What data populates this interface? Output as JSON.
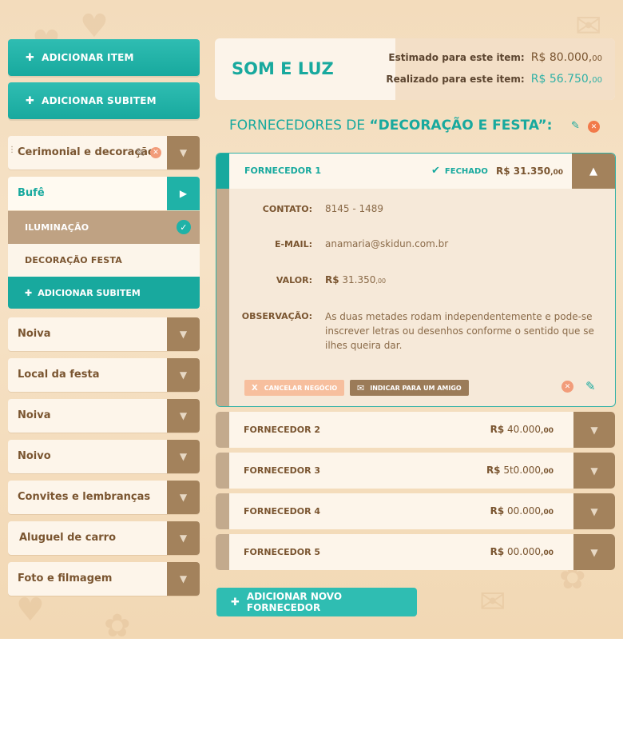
{
  "sidebar": {
    "add_item_label": "ADICIONAR ITEM",
    "add_subitem_label": "ADICIONAR SUBITEM",
    "categories": [
      {
        "label": "Cerimonial e decoração"
      },
      {
        "label": "Bufê"
      },
      {
        "label": "Noiva"
      },
      {
        "label": "Local da festa"
      },
      {
        "label": "Noiva"
      },
      {
        "label": "Noivo"
      },
      {
        "label": "Convites e lembranças"
      },
      {
        "label": "Aluguel de carro"
      },
      {
        "label": "Foto e filmagem"
      }
    ],
    "subitems": [
      {
        "label": "ILUMINAÇÃO",
        "selected": true
      },
      {
        "label": "DECORAÇÃO FESTA",
        "selected": false
      }
    ],
    "inline_add_subitem_label": "ADICIONAR SUBITEM"
  },
  "item": {
    "title": "SOM E LUZ",
    "estimated_label": "Estimado para este item:",
    "estimated_value": "R$ 80.000,",
    "estimated_cents": "00",
    "realized_label": "Realizado para este item:",
    "realized_value": "R$ 56.750,",
    "realized_cents": "00"
  },
  "section": {
    "title_prefix": "FORNECEDORES DE ",
    "title_category": "“DECORAÇÃO E FESTA”:"
  },
  "open_supplier": {
    "name": "FORNECEDOR 1",
    "status": "FECHADO",
    "price_prefix": "R$ 31.350",
    "price_cents": ",00",
    "contact_label": "CONTATO:",
    "contact_value": "8145 - 1489",
    "email_label": "E-MAIL:",
    "email_value": "anamaria@skidun.com.br",
    "value_label": "VALOR:",
    "value_currency": "R$",
    "value_amount": " 31.350",
    "value_cents": ",00",
    "note_label": "OBSERVAÇÃO:",
    "note_value": "As duas metades rodam independentemente e pode-se inscrever letras ou desenhos conforme o sentido que se ilhes queira dar.",
    "cancel_label": "CANCELAR NEGÓCIO",
    "invite_label": "INDICAR PARA UM AMIGO"
  },
  "suppliers": [
    {
      "name": "FORNECEDOR 2",
      "currency": "R$",
      "amount": " 40.000",
      "cents": ",00"
    },
    {
      "name": "FORNECEDOR 3",
      "currency": "R$",
      "amount": " 5t0.000",
      "cents": ",00"
    },
    {
      "name": "FORNECEDOR 4",
      "currency": "R$",
      "amount": " 00.000",
      "cents": ",00"
    },
    {
      "name": "FORNECEDOR 5",
      "currency": "R$",
      "amount": " 00.000",
      "cents": ",00"
    }
  ],
  "add_supplier_label": "ADICIONAR NOVO FORNECEDOR",
  "colors": {
    "teal": "#18a99e",
    "brown": "#a3825c",
    "cream": "#fdf5ea",
    "background": "#f3dcbc"
  }
}
